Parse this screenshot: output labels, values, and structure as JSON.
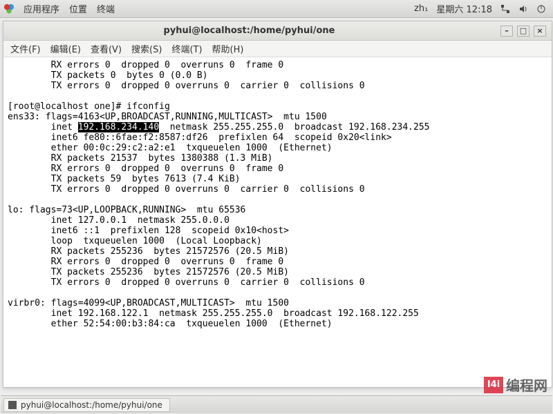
{
  "sys_panel": {
    "apps": "应用程序",
    "places": "位置",
    "terminal": "终端",
    "ime": "zh₁",
    "clock": "星期六 12:18"
  },
  "window": {
    "title": "pyhui@localhost:/home/pyhui/one",
    "btn_min": "–",
    "btn_max": "□",
    "btn_close": "×"
  },
  "menubar": {
    "file": "文件(F)",
    "edit": "编辑(E)",
    "view": "查看(V)",
    "search": "搜索(S)",
    "terminal": "终端(T)",
    "help": "帮助(H)"
  },
  "term": {
    "l01": "        RX errors 0  dropped 0  overruns 0  frame 0",
    "l02": "        TX packets 0  bytes 0 (0.0 B)",
    "l03": "        TX errors 0  dropped 0 overruns 0  carrier 0  collisions 0",
    "l05": "[root@localhost one]# ifconfig",
    "l06": "ens33: flags=4163<UP,BROADCAST,RUNNING,MULTICAST>  mtu 1500",
    "l07a": "        inet ",
    "l07h": "192.168.234.140",
    "l07b": "  netmask 255.255.255.0  broadcast 192.168.234.255",
    "l08": "        inet6 fe80::6fae:f2:8587:df26  prefixlen 64  scopeid 0x20<link>",
    "l09": "        ether 00:0c:29:c2:a2:e1  txqueuelen 1000  (Ethernet)",
    "l10": "        RX packets 21537  bytes 1380388 (1.3 MiB)",
    "l11": "        RX errors 0  dropped 0  overruns 0  frame 0",
    "l12": "        TX packets 59  bytes 7613 (7.4 KiB)",
    "l13": "        TX errors 0  dropped 0 overruns 0  carrier 0  collisions 0",
    "l15": "lo: flags=73<UP,LOOPBACK,RUNNING>  mtu 65536",
    "l16": "        inet 127.0.0.1  netmask 255.0.0.0",
    "l17": "        inet6 ::1  prefixlen 128  scopeid 0x10<host>",
    "l18": "        loop  txqueuelen 1000  (Local Loopback)",
    "l19": "        RX packets 255236  bytes 21572576 (20.5 MiB)",
    "l20": "        RX errors 0  dropped 0  overruns 0  frame 0",
    "l21": "        TX packets 255236  bytes 21572576 (20.5 MiB)",
    "l22": "        TX errors 0  dropped 0 overruns 0  carrier 0  collisions 0",
    "l24": "virbr0: flags=4099<UP,BROADCAST,MULTICAST>  mtu 1500",
    "l25": "        inet 192.168.122.1  netmask 255.255.255.0  broadcast 192.168.122.255",
    "l26": "        ether 52:54:00:b3:84:ca  txqueuelen 1000  (Ethernet)"
  },
  "taskbar": {
    "item1": "pyhui@localhost:/home/pyhui/one"
  },
  "watermark": {
    "logo": "I4i",
    "text": "编程网"
  }
}
